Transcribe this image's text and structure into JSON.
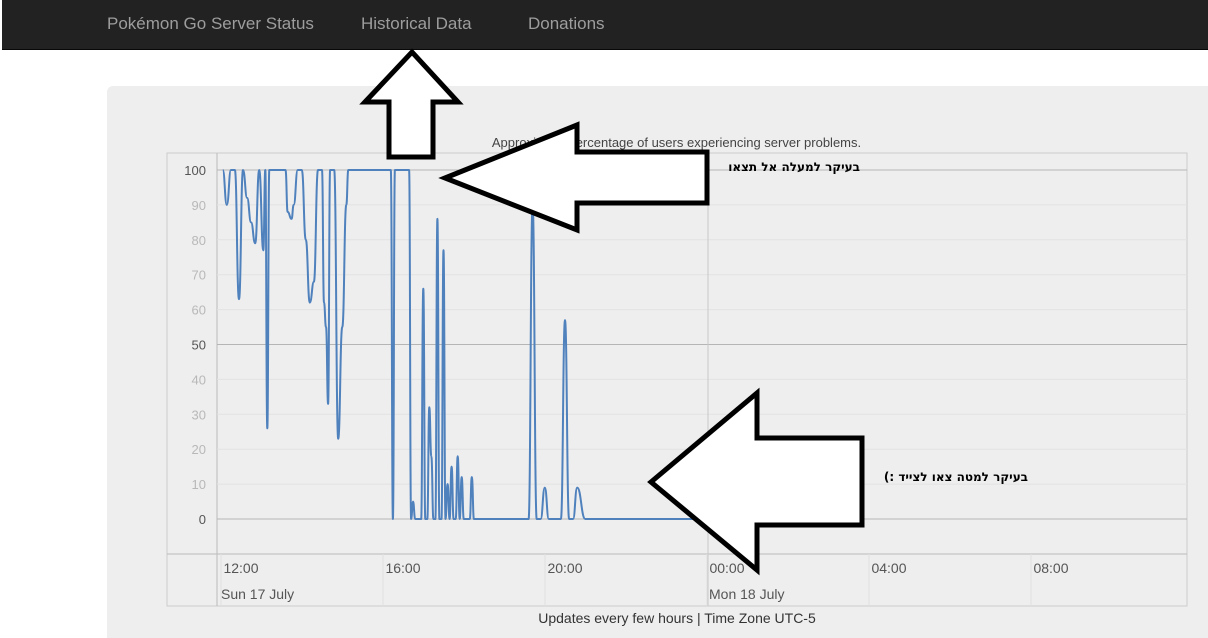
{
  "nav": {
    "brand": "Pokémon Go Server Status",
    "historical": "Historical Data",
    "donations": "Donations"
  },
  "chart_data": {
    "type": "line",
    "title": "Approximate percentage of users experiencing server problems.",
    "footer": "Updates every few hours | Time Zone UTC-5",
    "xlabel": "",
    "ylabel": "",
    "ylim": [
      0,
      100
    ],
    "y_ticks": [
      "100",
      "90",
      "80",
      "70",
      "60",
      "50",
      "40",
      "30",
      "20",
      "10",
      "0"
    ],
    "x_ticks": [
      "12:00",
      "16:00",
      "20:00",
      "00:00",
      "04:00",
      "08:00"
    ],
    "x_range_hours": [
      11.5,
      35.25
    ],
    "date_labels": [
      {
        "text": "Sun 17 July",
        "hour": 12
      },
      {
        "text": "Mon 18 July",
        "hour": 24
      }
    ],
    "grid": true,
    "series": [
      {
        "color": "#4f81bd",
        "x_hours": [
          11.55,
          11.65,
          11.75,
          11.85,
          11.95,
          12.05,
          12.15,
          12.25,
          12.35,
          12.45,
          12.55,
          12.6,
          12.65,
          12.7,
          12.8,
          12.9,
          13.0,
          13.1,
          13.15,
          13.25,
          13.3,
          13.4,
          13.5,
          13.6,
          13.7,
          13.8,
          13.9,
          14.0,
          14.05,
          14.1,
          14.15,
          14.2,
          14.25,
          14.3,
          14.4,
          14.5,
          14.6,
          14.65,
          14.7,
          14.75,
          14.8,
          14.85,
          14.9,
          14.95,
          15.0,
          15.1,
          15.2,
          15.3,
          15.4,
          15.5,
          15.6,
          15.65,
          15.7,
          15.75,
          15.8,
          15.85,
          15.9,
          15.95,
          16.0,
          16.05,
          16.1,
          16.15,
          16.2,
          16.25,
          16.3,
          16.35,
          16.4,
          16.45,
          16.5,
          16.55,
          16.6,
          16.65,
          16.7,
          16.75,
          16.8,
          16.85,
          16.9,
          16.95,
          17.0,
          17.05,
          17.1,
          17.15,
          17.2,
          17.25,
          17.3,
          17.35,
          17.4,
          17.45,
          17.5,
          17.55,
          17.6,
          17.65,
          17.7,
          17.75,
          17.8,
          17.85,
          17.9,
          17.95,
          18.0,
          18.1,
          18.2,
          18.3,
          18.4,
          18.5,
          18.6,
          18.7,
          18.8,
          18.9,
          19.0,
          19.1,
          19.2,
          19.3,
          19.4,
          19.5,
          19.6,
          19.7,
          19.8,
          19.9,
          20.0,
          20.1,
          20.2,
          20.3,
          20.5,
          21.0,
          21.5,
          22.0,
          22.5,
          23.0,
          23.5
        ],
        "y": [
          100,
          90,
          100,
          100,
          63,
          100,
          92,
          85,
          79,
          100,
          77,
          100,
          26,
          100,
          100,
          100,
          100,
          100,
          88,
          86,
          90,
          100,
          100,
          80,
          62,
          68,
          100,
          100,
          62,
          55,
          33,
          100,
          100,
          100,
          23,
          55,
          90,
          100,
          100,
          100,
          100,
          100,
          100,
          100,
          100,
          100,
          100,
          100,
          100,
          100,
          100,
          100,
          100,
          0,
          100,
          100,
          100,
          100,
          100,
          100,
          100,
          100,
          0,
          5,
          0,
          0,
          0,
          0,
          66,
          0,
          0,
          32,
          18,
          0,
          0,
          86,
          0,
          0,
          77,
          0,
          10,
          0,
          15,
          0,
          0,
          18,
          0,
          12,
          0,
          0,
          0,
          0,
          12,
          0,
          0,
          0,
          0,
          0,
          0,
          0,
          0,
          0,
          0,
          0,
          0,
          0,
          0,
          0,
          0,
          0,
          90,
          0,
          0,
          9,
          0,
          0,
          0,
          0,
          57,
          0,
          0,
          9,
          0,
          0,
          0,
          0,
          0,
          0,
          0
        ]
      }
    ]
  },
  "annotations": {
    "upper_text": "בעיקר למעלה אל תצאו",
    "lower_text": "בעיקר למטה צאו לצייד :)"
  }
}
